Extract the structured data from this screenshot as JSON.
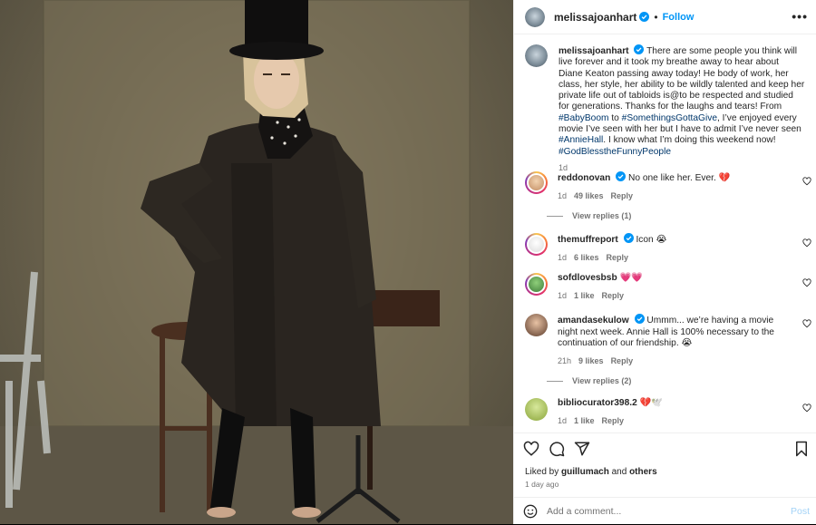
{
  "header": {
    "username": "melissajoanhart",
    "separator": "•",
    "follow_label": "Follow",
    "more_label": "•••"
  },
  "caption": {
    "username": "melissajoanhart",
    "text_1": "There are some people you think will live forever and it took my breathe away to hear about Diane Keaton passing away today! He body of work, her class, her style, her ability to be wildly talented and keep her private life out of tabloids is@to be respected and studied for generations. Thanks for the laughs and tears! From ",
    "tag_1": "#BabyBoom",
    "text_2": " to ",
    "tag_2": "#SomethingsGottaGive",
    "text_3": ", I’ve enjoyed every movie I’ve seen with her but I have to admit I’ve never seen ",
    "tag_3": "#AnnieHall",
    "text_4": ". I know what I’m doing this weekend now! ",
    "tag_4": "#GodBlesstheFunnyPeople",
    "time": "1d"
  },
  "comments": [
    {
      "username": "reddonovan",
      "text": "No one like her. Ever. 💔",
      "time": "1d",
      "likes": "49 likes",
      "reply": "Reply",
      "view_replies": "View replies (1)"
    },
    {
      "username": "themuffreport",
      "text": "Icon 😭",
      "time": "1d",
      "likes": "6 likes",
      "reply": "Reply"
    },
    {
      "username": "sofdlovesbsb",
      "text": "💗💗",
      "time": "1d",
      "likes": "1 like",
      "reply": "Reply"
    },
    {
      "username": "amandasekulow",
      "text": "Ummm... we’re having a movie night next week. Annie Hall is 100% necessary to the continuation of our friendship. 😭",
      "time": "21h",
      "likes": "9 likes",
      "reply": "Reply",
      "view_replies": "View replies (2)"
    },
    {
      "username": "bibliocurator398.2",
      "text": "💔🕊️",
      "time": "1d",
      "likes": "1 like",
      "reply": "Reply"
    }
  ],
  "footer": {
    "liked_by_prefix": "Liked by",
    "liked_by_user": "guillumach",
    "liked_by_and": "and",
    "liked_by_others": "others",
    "time_ago": "1 day ago",
    "add_comment_placeholder": "Add a comment...",
    "post_label": "Post"
  },
  "colors": {
    "accent": "#0095f6",
    "verified": "#0095f6",
    "post_disabled": "#a3d3f7"
  },
  "icons": [
    "verified-badge-icon",
    "more-options-icon",
    "heart-icon",
    "comment-icon",
    "share-icon",
    "bookmark-icon",
    "emoji-icon"
  ]
}
